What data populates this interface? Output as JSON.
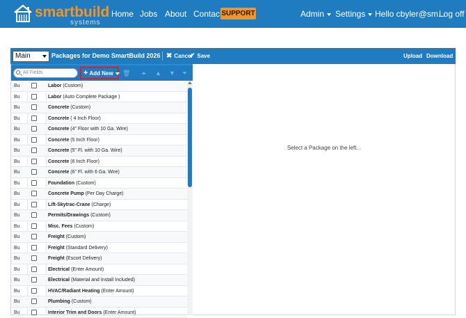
{
  "brand": {
    "name_part1": "smart",
    "name_part2": "build",
    "tagline": "systems"
  },
  "nav": {
    "home": "Home",
    "jobs": "Jobs",
    "about": "About",
    "contact": "Contact",
    "support": "SUPPORT",
    "admin": "Admin",
    "settings": "Settings",
    "user": "Hello cbyler@sm...",
    "logoff": "Log off"
  },
  "toolbar": {
    "selected_view": "Main",
    "title": "Packages for Demo SmartBuild 2026",
    "cancel": "Cancel",
    "save": "Save",
    "upload": "Upload",
    "download": "Download"
  },
  "list_toolbar": {
    "search_placeholder": "All Fields",
    "add_new": "Add New"
  },
  "rows": [
    {
      "type": "Bu",
      "name": "Labor",
      "detail": "(Custom)"
    },
    {
      "type": "Bu",
      "name": "Labor",
      "detail": "(Auto Complete Package )"
    },
    {
      "type": "Bu",
      "name": "Concrete",
      "detail": "(Custom)"
    },
    {
      "type": "Bu",
      "name": "Concrete",
      "detail": "( 4 Inch Floor)"
    },
    {
      "type": "Bu",
      "name": "Concrete",
      "detail": "(4\" Floor with 10 Ga. Wire)"
    },
    {
      "type": "Bu",
      "name": "Concrete",
      "detail": "(5 Inch Floor)"
    },
    {
      "type": "Bu",
      "name": "Concrete",
      "detail": "(5\" Fl. with 10 Ga. Wire)"
    },
    {
      "type": "Bu",
      "name": "Concrete",
      "detail": "(6 Inch Floor)"
    },
    {
      "type": "Bu",
      "name": "Concrete",
      "detail": "(6\" Fl. with 6 Ga. Wire)"
    },
    {
      "type": "Bu",
      "name": "Foundation",
      "detail": "(Custom)"
    },
    {
      "type": "Bu",
      "name": "Concrete Pump",
      "detail": "(Per Day Charge)"
    },
    {
      "type": "Bu",
      "name": "Lift-Skytrac-Crane",
      "detail": "(Charge)"
    },
    {
      "type": "Bu",
      "name": "Permits/Drawings",
      "detail": "(Custom)"
    },
    {
      "type": "Bu",
      "name": "Misc. Fees",
      "detail": "(Custom)"
    },
    {
      "type": "Bu",
      "name": "Freight",
      "detail": "(Custom)"
    },
    {
      "type": "Bu",
      "name": "Freight",
      "detail": "(Standard Delivery)"
    },
    {
      "type": "Bu",
      "name": "Freight",
      "detail": "(Escort Delivery)"
    },
    {
      "type": "Bu",
      "name": "Electrical",
      "detail": "(Enter Amount)"
    },
    {
      "type": "Bu",
      "name": "Electrical",
      "detail": "(Material and Install Included)"
    },
    {
      "type": "Bu",
      "name": "HVAC/Radiant Heating",
      "detail": "(Enter Amount)"
    },
    {
      "type": "Bu",
      "name": "Plumbing",
      "detail": "(Custom)"
    },
    {
      "type": "Bu",
      "name": "Interior Trim and Doors",
      "detail": "(Enter Amount)"
    }
  ],
  "detail": {
    "empty_message": "Select a Package on the left..."
  },
  "colors": {
    "primary": "#1f7cc1",
    "accent": "#f7941e",
    "highlight": "#d9212a"
  }
}
